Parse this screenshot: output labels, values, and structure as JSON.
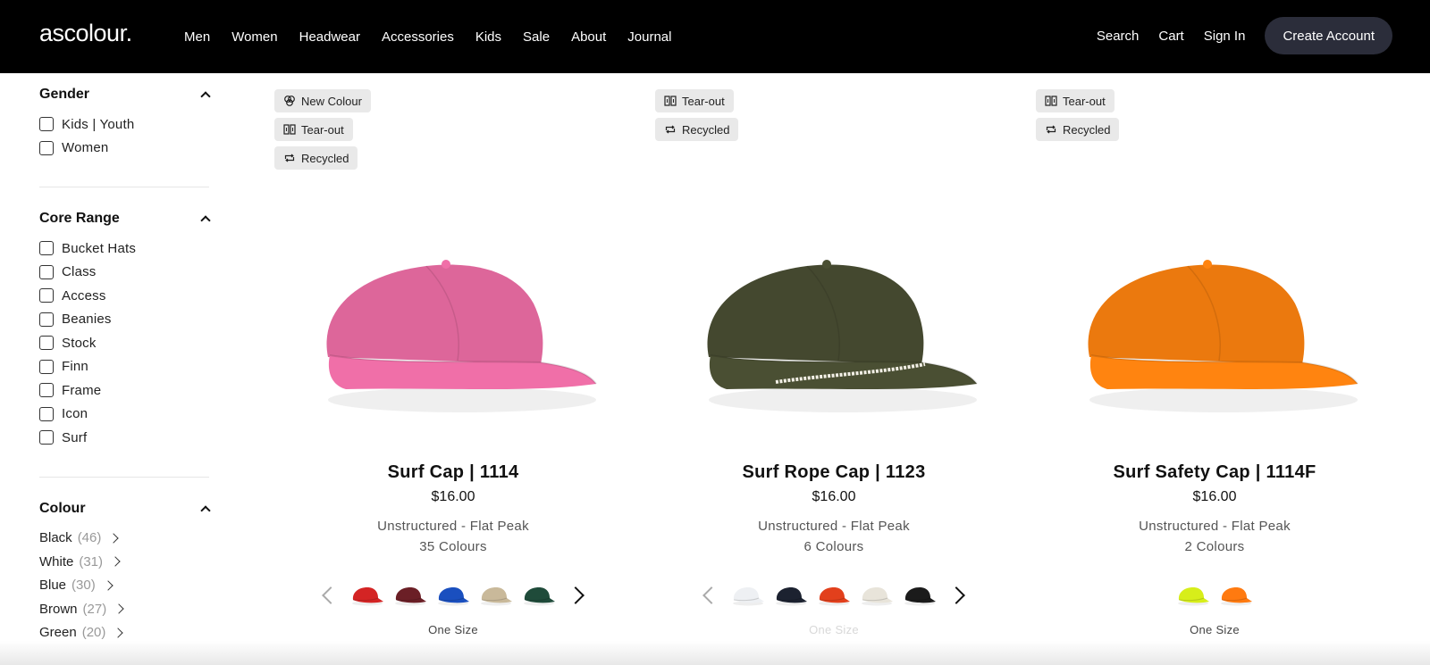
{
  "header": {
    "logo": "ascolour.",
    "nav": [
      "Men",
      "Women",
      "Headwear",
      "Accessories",
      "Kids",
      "Sale",
      "About",
      "Journal"
    ],
    "search": "Search",
    "cart": "Cart",
    "sign_in": "Sign In",
    "create_account": "Create Account"
  },
  "filters": {
    "gender": {
      "title": "Gender",
      "options": [
        "Kids | Youth",
        "Women"
      ]
    },
    "core_range": {
      "title": "Core Range",
      "options": [
        "Bucket Hats",
        "Class",
        "Access",
        "Beanies",
        "Stock",
        "Finn",
        "Frame",
        "Icon",
        "Surf"
      ]
    },
    "colour": {
      "title": "Colour",
      "options": [
        {
          "name": "Black",
          "count": "(46)"
        },
        {
          "name": "White",
          "count": "(31)"
        },
        {
          "name": "Blue",
          "count": "(30)"
        },
        {
          "name": "Brown",
          "count": "(27)"
        },
        {
          "name": "Green",
          "count": "(20)"
        }
      ]
    }
  },
  "products": [
    {
      "tags": [
        {
          "label": "New Colour",
          "icon": "palette-icon"
        },
        {
          "label": "Tear-out",
          "icon": "tear-out-icon"
        },
        {
          "label": "Recycled",
          "icon": "recycle-icon"
        }
      ],
      "name": "Surf Cap | 1114",
      "price": "$16.00",
      "description": "Unstructured - Flat Peak",
      "colours": "35 Colours",
      "cap_color": "#f06fa8",
      "swatches": [
        "#d42424",
        "#6b1f26",
        "#1a4fbf",
        "#c9b99a",
        "#1f4b3a"
      ],
      "size": "One Size"
    },
    {
      "tags": [
        {
          "label": "Tear-out",
          "icon": "tear-out-icon"
        },
        {
          "label": "Recycled",
          "icon": "recycle-icon"
        }
      ],
      "name": "Surf Rope Cap | 1123",
      "price": "$16.00",
      "description": "Unstructured - Flat Peak",
      "colours": "6 Colours",
      "cap_color": "#4a4f33",
      "swatches": [
        "#eef0f3",
        "#1c2230",
        "#e2401c",
        "#e8e4da",
        "#1b1b1b"
      ],
      "size": "One Size"
    },
    {
      "tags": [
        {
          "label": "Tear-out",
          "icon": "tear-out-icon"
        },
        {
          "label": "Recycled",
          "icon": "recycle-icon"
        }
      ],
      "name": "Surf Safety Cap | 1114F",
      "price": "$16.00",
      "description": "Unstructured - Flat Peak",
      "colours": "2 Colours",
      "cap_color": "#ff8410",
      "swatches": [
        "#d7ee1a",
        "#ff7a10"
      ],
      "size": "One Size"
    }
  ]
}
